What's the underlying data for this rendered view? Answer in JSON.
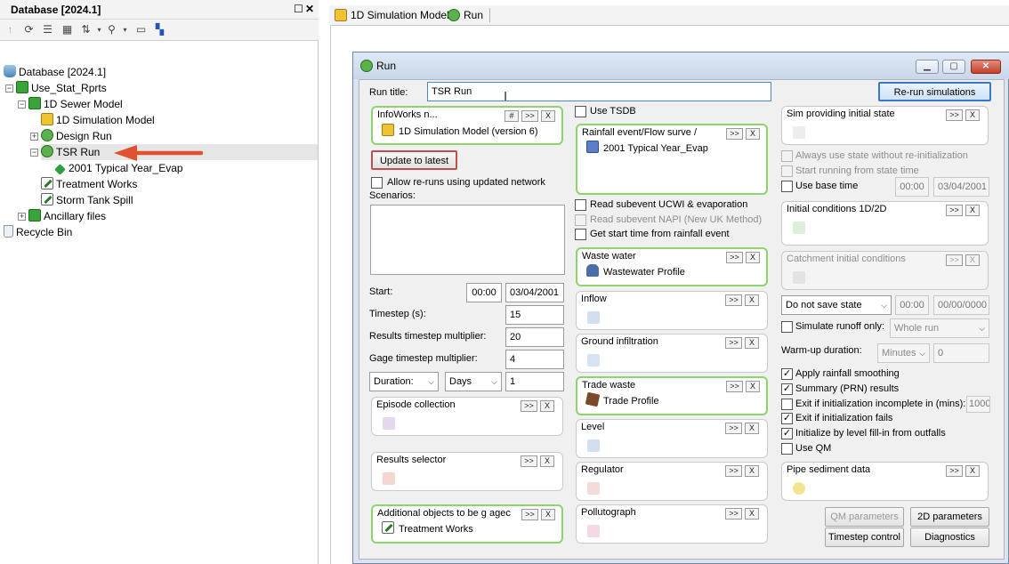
{
  "left_panel": {
    "title": "Database [2024.1]",
    "pin_symbol": "☐",
    "close_symbol": "✕",
    "tree": [
      {
        "label": "Database [2024.1]",
        "icon": "database-icon"
      },
      {
        "label": "Use_Stat_Rprts",
        "icon": "group-icon"
      },
      {
        "label": "1D Sewer Model",
        "icon": "model-group-icon"
      },
      {
        "label": "1D Simulation Model",
        "icon": "simulation-model-icon"
      },
      {
        "label": "Design Run",
        "icon": "run-icon"
      },
      {
        "label": "TSR Run",
        "icon": "run-icon"
      },
      {
        "label": "2001 Typical Year_Evap",
        "icon": "simulation-icon"
      },
      {
        "label": "Treatment Works",
        "icon": "pencil-icon"
      },
      {
        "label": "Storm Tank Spill",
        "icon": "pencil-icon"
      },
      {
        "label": "Ancillary files",
        "icon": "group-icon"
      },
      {
        "label": "Recycle Bin",
        "icon": "recycle-bin-icon"
      }
    ]
  },
  "tabs": [
    {
      "label": "1D Simulation Model",
      "icon": "simulation-model-icon"
    },
    {
      "label": "Run",
      "icon": "run-icon"
    }
  ],
  "dialog": {
    "title": "Run",
    "run_title_label": "Run title:",
    "run_title_value": "TSR Run",
    "rerun_button": "Re-run simulations",
    "infoworks": {
      "title": "InfoWorks n...",
      "hash": "#",
      "more": ">>",
      "clear": "X",
      "item": "1D Simulation Model (version 6)"
    },
    "update_button": "Update to latest",
    "allow_reruns": "Allow re-runs using updated network",
    "scenarios_label": "Scenarios:",
    "start_label": "Start:",
    "start_time": "00:00",
    "start_date": "03/04/2001",
    "timestep_label": "Timestep (s):",
    "timestep_value": "15",
    "results_mult_label": "Results timestep multiplier:",
    "results_mult_value": "20",
    "gage_mult_label": "Gage timestep multiplier:",
    "gage_mult_value": "4",
    "duration_select": "Duration:",
    "duration_unit": "Days",
    "duration_value": "1",
    "episode_title": "Episode collection",
    "results_selector_title": "Results selector",
    "additional_title": "Additional objects to be g agec",
    "additional_item": "Treatment Works",
    "use_tsdb": "Use TSDB",
    "rainfall_title": "Rainfall event/Flow surve /",
    "rainfall_item": "2001 Typical Year_Evap",
    "read_ucwi": "Read subevent UCWI & evaporation",
    "read_napi": "Read subevent NAPI (New UK Method)",
    "get_start_time": "Get start time from rainfall event",
    "waste_water_title": "Waste water",
    "waste_water_item": "Wastewater Profile",
    "inflow_title": "Inflow",
    "ground_infiltration_title": "Ground infiltration",
    "trade_waste_title": "Trade waste",
    "trade_waste_item": "Trade Profile",
    "level_title": "Level",
    "regulator_title": "Regulator",
    "pollutograph_title": "Pollutograph",
    "sim_state_title": "Sim providing initial state",
    "always_use_state": "Always use state without re-initialization",
    "start_running": "Start running from state time",
    "use_base_time": "Use base time",
    "base_time": "00:00",
    "base_date": "03/04/2001",
    "initial_conditions_title": "Initial conditions 1D/2D",
    "catchment_title": "Catchment initial conditions",
    "save_state_select": "Do not save state",
    "save_time": "00:00",
    "save_date": "00/00/0000",
    "simulate_runoff": "Simulate runoff only:",
    "whole_run": "Whole run",
    "warmup_label": "Warm-up duration:",
    "warmup_unit": "Minutes",
    "warmup_value": "0",
    "apply_rainfall": "Apply rainfall smoothing",
    "summary_results": "Summary (PRN) results",
    "exit_incomplete": "Exit if initialization incomplete in (mins):",
    "exit_incomplete_value": "1000",
    "exit_fails": "Exit if initialization fails",
    "init_level": "Initialize by level fill-in from outfalls",
    "use_qm": "Use QM",
    "pipe_sediment_title": "Pipe sediment data",
    "qm_parameters": "QM parameters",
    "two_d_parameters": "2D parameters",
    "timestep_control": "Timestep control",
    "diagnostics": "Diagnostics",
    "more": ">>",
    "clear": "X"
  }
}
